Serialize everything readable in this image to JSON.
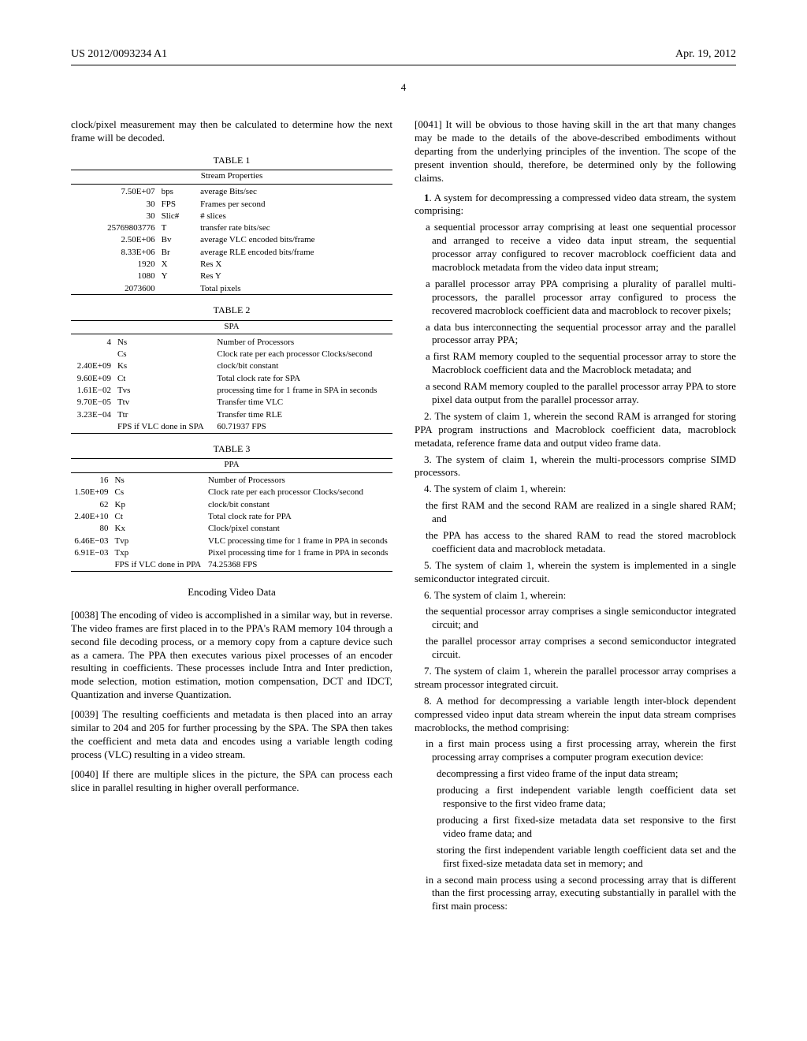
{
  "header": {
    "pub_number": "US 2012/0093234 A1",
    "date": "Apr. 19, 2012"
  },
  "page_number": "4",
  "left": {
    "top_para": "clock/pixel measurement may then be calculated to determine how the next frame will be decoded.",
    "table1": {
      "label": "TABLE 1",
      "caption": "Stream Properties",
      "rows": [
        {
          "val": "7.50E+07",
          "sym": "bps",
          "desc": "average Bits/sec"
        },
        {
          "val": "30",
          "sym": "FPS",
          "desc": "Frames per second"
        },
        {
          "val": "30",
          "sym": "Slic#",
          "desc": "# slices"
        },
        {
          "val": "25769803776",
          "sym": "T",
          "desc": "transfer rate bits/sec"
        },
        {
          "val": "2.50E+06",
          "sym": "Bv",
          "desc": "average VLC encoded bits/frame"
        },
        {
          "val": "8.33E+06",
          "sym": "Br",
          "desc": "average RLE encoded bits/frame"
        },
        {
          "val": "1920",
          "sym": "X",
          "desc": "Res X"
        },
        {
          "val": "1080",
          "sym": "Y",
          "desc": "Res Y"
        },
        {
          "val": "2073600",
          "sym": "",
          "desc": "Total pixels"
        }
      ]
    },
    "table2": {
      "label": "TABLE 2",
      "caption": "SPA",
      "rows": [
        {
          "val": "4",
          "sym": "Ns",
          "desc": "Number of Processors"
        },
        {
          "val": "",
          "sym": "Cs",
          "desc": "Clock rate per each processor Clocks/second"
        },
        {
          "val": "2.40E+09",
          "sym": "Ks",
          "desc": "clock/bit constant"
        },
        {
          "val": "9.60E+09",
          "sym": "Ct",
          "desc": "Total clock rate for SPA"
        },
        {
          "val": "1.61E−02",
          "sym": "Tvs",
          "desc": "processing time for 1 frame in SPA in seconds"
        },
        {
          "val": "9.70E−05",
          "sym": "Ttv",
          "desc": "Transfer time VLC"
        },
        {
          "val": "3.23E−04",
          "sym": "Ttr",
          "desc": "Transfer time RLE"
        },
        {
          "val": "",
          "sym": "FPS if VLC done in SPA",
          "desc": "60.71937 FPS"
        }
      ]
    },
    "table3": {
      "label": "TABLE 3",
      "caption": "PPA",
      "rows": [
        {
          "val": "16",
          "sym": "Ns",
          "desc": "Number of Processors"
        },
        {
          "val": "1.50E+09",
          "sym": "Cs",
          "desc": "Clock rate per each processor Clocks/second"
        },
        {
          "val": "62",
          "sym": "Kp",
          "desc": "clock/bit constant"
        },
        {
          "val": "2.40E+10",
          "sym": "Ct",
          "desc": "Total clock rate for PPA"
        },
        {
          "val": "80",
          "sym": "Kx",
          "desc": "Clock/pixel constant"
        },
        {
          "val": "6.46E−03",
          "sym": "Tvp",
          "desc": "VLC processing time for 1 frame in PPA in seconds"
        },
        {
          "val": "6.91E−03",
          "sym": "Txp",
          "desc": "Pixel processing time for 1 frame in PPA in seconds"
        },
        {
          "val": "",
          "sym": "FPS if VLC done in PPA",
          "desc": "74.25368 FPS"
        }
      ]
    },
    "heading": "Encoding Video Data",
    "p38": "[0038]    The encoding of video is accomplished in a similar way, but in reverse. The video frames are first placed in to the PPA's RAM memory 104 through a second file decoding process, or a memory copy from a capture device such as a camera. The PPA then executes various pixel processes of an encoder resulting in coefficients. These processes include Intra and Inter prediction, mode selection, motion estimation, motion compensation, DCT and IDCT, Quantization and inverse Quantization.",
    "p39": "[0039]    The resulting coefficients and metadata is then placed into an array similar to 204 and 205 for further processing by the SPA. The SPA then takes the coefficient and meta data and encodes using a variable length coding process (VLC) resulting in a video stream.",
    "p40": "[0040]    If there are multiple slices in the picture, the SPA can process each slice in parallel resulting in higher overall performance."
  },
  "right": {
    "p41": "[0041]    It will be obvious to those having skill in the art that many changes may be made to the details of the above-described embodiments without departing from the underlying principles of the invention. The scope of the present invention should, therefore, be determined only by the following claims.",
    "claim1": {
      "num": "1",
      "lead": ". A system for decompressing a compressed video data stream, the system comprising:",
      "sub": [
        "a sequential processor array comprising at least one sequential processor and arranged to receive a video data input stream, the sequential processor array configured to recover macroblock coefficient data and macroblock metadata from the video data input stream;",
        "a parallel processor array PPA comprising a plurality of parallel multi-processors, the parallel processor array configured to process the recovered macroblock coefficient data and macroblock to recover pixels;",
        "a data bus interconnecting the sequential processor array and the parallel processor array PPA;",
        "a first RAM memory coupled to the sequential processor array to store the Macroblock coefficient data and the Macroblock metadata; and",
        "a second RAM memory coupled to the parallel processor array PPA to store pixel data output from the parallel processor array."
      ]
    },
    "claim2": "2. The system of claim 1, wherein the second RAM is arranged for storing PPA program instructions and Macroblock coefficient data, macroblock metadata, reference frame data and output video frame data.",
    "claim3": "3. The system of claim 1, wherein the multi-processors comprise SIMD processors.",
    "claim4": {
      "lead": "4. The system of claim 1, wherein:",
      "sub": [
        "the first RAM and the second RAM are realized in a single shared RAM; and",
        "the PPA has access to the shared RAM to read the stored macroblock coefficient data and macroblock metadata."
      ]
    },
    "claim5": "5. The system of claim 1, wherein the system is implemented in a single semiconductor integrated circuit.",
    "claim6": {
      "lead": "6. The system of claim 1, wherein:",
      "sub": [
        "the sequential processor array comprises a single semiconductor integrated circuit; and",
        "the parallel processor array comprises a second semiconductor integrated circuit."
      ]
    },
    "claim7": "7. The system of claim 1, wherein the parallel processor array comprises a stream processor integrated circuit.",
    "claim8": {
      "lead": "8. A method for decompressing a variable length inter-block dependent compressed video input data stream wherein the input data stream comprises macroblocks, the method comprising:",
      "sub": [
        "in a first main process using a first processing array, wherein the first processing array comprises a computer program execution device:"
      ],
      "sub2": [
        "decompressing a first video frame of the input data stream;",
        "producing a first independent variable length coefficient data set responsive to the first video frame data;",
        "producing a first fixed-size metadata data set responsive to the first video frame data; and",
        "storing the first independent variable length coefficient data set and the first fixed-size metadata data set in memory; and"
      ],
      "sub_after": [
        "in a second main process using a second processing array that is different than the first processing array, executing substantially in parallel with the first main process:"
      ]
    }
  }
}
